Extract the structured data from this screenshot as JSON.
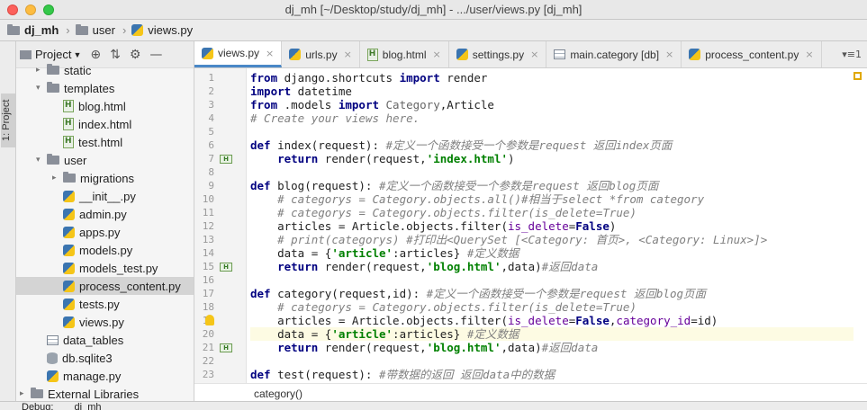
{
  "window": {
    "title": "dj_mh [~/Desktop/study/dj_mh] - .../user/views.py [dj_mh]"
  },
  "breadcrumb": {
    "project": "dj_mh",
    "folder": "user",
    "file": "views.py"
  },
  "sidebar": {
    "tool_label": "1: Project"
  },
  "project_panel": {
    "title": "Project",
    "tree": [
      {
        "label": "static",
        "icon": "folder-icon",
        "indent": 1,
        "arrow": "▸"
      },
      {
        "label": "templates",
        "icon": "folder-icon",
        "indent": 1,
        "arrow": "▾"
      },
      {
        "label": "blog.html",
        "icon": "html-file-icon",
        "indent": 2,
        "arrow": ""
      },
      {
        "label": "index.html",
        "icon": "html-file-icon",
        "indent": 2,
        "arrow": ""
      },
      {
        "label": "test.html",
        "icon": "html-file-icon",
        "indent": 2,
        "arrow": ""
      },
      {
        "label": "user",
        "icon": "folder-icon",
        "indent": 1,
        "arrow": "▾"
      },
      {
        "label": "migrations",
        "icon": "folder-icon",
        "indent": 2,
        "arrow": "▸"
      },
      {
        "label": "__init__.py",
        "icon": "python-file-icon",
        "indent": 2,
        "arrow": ""
      },
      {
        "label": "admin.py",
        "icon": "python-file-icon",
        "indent": 2,
        "arrow": ""
      },
      {
        "label": "apps.py",
        "icon": "python-file-icon",
        "indent": 2,
        "arrow": ""
      },
      {
        "label": "models.py",
        "icon": "python-file-icon",
        "indent": 2,
        "arrow": ""
      },
      {
        "label": "models_test.py",
        "icon": "python-file-icon",
        "indent": 2,
        "arrow": ""
      },
      {
        "label": "process_content.py",
        "icon": "python-file-icon",
        "indent": 2,
        "arrow": "",
        "selected": true
      },
      {
        "label": "tests.py",
        "icon": "python-file-icon",
        "indent": 2,
        "arrow": ""
      },
      {
        "label": "views.py",
        "icon": "python-file-icon",
        "indent": 2,
        "arrow": ""
      },
      {
        "label": "data_tables",
        "icon": "table-icon",
        "indent": 1,
        "arrow": ""
      },
      {
        "label": "db.sqlite3",
        "icon": "database-icon",
        "indent": 1,
        "arrow": ""
      },
      {
        "label": "manage.py",
        "icon": "python-file-icon",
        "indent": 1,
        "arrow": ""
      },
      {
        "label": "External Libraries",
        "icon": "library-icon",
        "indent": 0,
        "arrow": "▸"
      }
    ]
  },
  "tabs": [
    {
      "label": "views.py",
      "icon": "python-file-icon",
      "active": true
    },
    {
      "label": "urls.py",
      "icon": "python-file-icon"
    },
    {
      "label": "blog.html",
      "icon": "html-file-icon"
    },
    {
      "label": "settings.py",
      "icon": "python-file-icon"
    },
    {
      "label": "main.category [db]",
      "icon": "table-icon"
    },
    {
      "label": "process_content.py",
      "icon": "python-file-icon"
    }
  ],
  "tab_overflow": "▾≡1",
  "code_lines": [
    {
      "n": "1",
      "html": "<span class='kw'>from</span> django.shortcuts <span class='kw'>import</span> render"
    },
    {
      "n": "2",
      "html": "<span class='kw'>import</span> datetime"
    },
    {
      "n": "3",
      "html": "<span class='kw'>from</span> .models <span class='kw'>import</span> <span class='cls'>Category</span>,Article"
    },
    {
      "n": "4",
      "html": "<span class='cmt'># Create your views here.</span>"
    },
    {
      "n": "5",
      "html": ""
    },
    {
      "n": "6",
      "html": "<span class='kw'>def</span> index(request): <span class='cmt'>#定义一个函数接受一个参数是request 返回index页面</span>"
    },
    {
      "n": "7",
      "html": "    <span class='kw'>return</span> render(request,<span class='str'>'index.html'</span>)",
      "mark": true
    },
    {
      "n": "8",
      "html": ""
    },
    {
      "n": "9",
      "html": "<span class='kw'>def</span> blog(request): <span class='cmt'>#定义一个函数接受一个参数是request 返回blog页面</span>"
    },
    {
      "n": "10",
      "html": "    <span class='cmt'># categorys = Category.objects.all()#相当于select *from category</span>"
    },
    {
      "n": "11",
      "html": "    <span class='cmt'># categorys = Category.objects.filter(is_delete=True)</span>"
    },
    {
      "n": "12",
      "html": "    articles = Article.objects.filter(<span class='param'>is_delete</span>=<span class='bool'>False</span>)"
    },
    {
      "n": "13",
      "html": "    <span class='cmt'># print(categorys) #打印出&lt;QuerySet [&lt;Category: 首页&gt;, &lt;Category: Linux&gt;]&gt;</span>"
    },
    {
      "n": "14",
      "html": "    data = {<span class='str'>'article'</span>:articles} <span class='cmt'>#定义数据</span>"
    },
    {
      "n": "15",
      "html": "    <span class='kw'>return</span> render(request,<span class='str'>'blog.html'</span>,data)<span class='cmt'>#返回data</span>",
      "mark": true
    },
    {
      "n": "16",
      "html": ""
    },
    {
      "n": "17",
      "html": "<span class='kw'>def</span> category(request,id): <span class='cmt'>#定义一个函数接受一个参数是request 返回blog页面</span>"
    },
    {
      "n": "18",
      "html": "    <span class='cmt'># categorys = Category.objects.filter(is_delete=True)</span>"
    },
    {
      "n": "19",
      "html": "    articles = Article.objects.filter(<span class='param'>is_delete</span>=<span class='bool'>False</span>,<span class='param'>category_id</span>=id)",
      "bulb": true
    },
    {
      "n": "20",
      "html": "    data = {<span class='str'>'article'</span>:articles} <span class='cmt'>#定义数据</span>",
      "current": true
    },
    {
      "n": "21",
      "html": "    <span class='kw'>return</span> render(request,<span class='str'>'blog.html'</span>,data)<span class='cmt'>#返回data</span>",
      "mark": true
    },
    {
      "n": "22",
      "html": ""
    },
    {
      "n": "23",
      "html": "<span class='kw'>def</span> test(request): <span class='cmt'>#带数据的返回 返回data中的数据</span>"
    }
  ],
  "status": {
    "function_breadcrumb": "category()"
  },
  "debug": {
    "label": "Debug:",
    "config": "dj_mh"
  }
}
